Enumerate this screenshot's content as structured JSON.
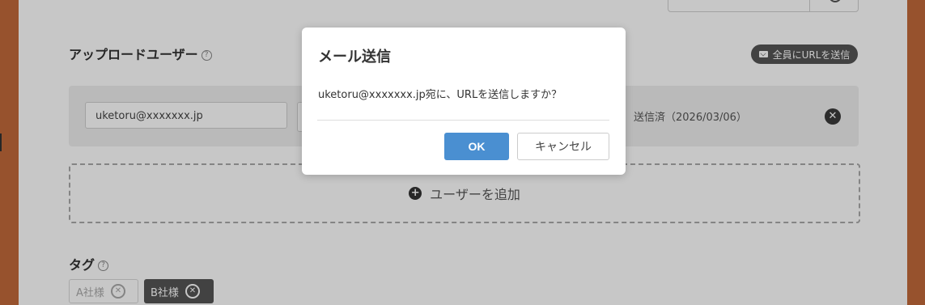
{
  "background": {
    "uploaders_section": {
      "title": "アップロードユーザー",
      "help_icon": "?",
      "send_all_button": "全員にURLを送信",
      "user": {
        "email": "uketoru@xxxxxxx.jp",
        "status": "送信済（2026/03/06）"
      },
      "add_user_label": "ユーザーを追加"
    },
    "tags_section": {
      "title": "タグ",
      "help_icon": "?",
      "tags": [
        "A社様",
        "B社様"
      ]
    }
  },
  "dialog": {
    "title": "メール送信",
    "message": "uketoru@xxxxxxx.jp宛に、URLを送信しますか？",
    "ok_label": "OK",
    "cancel_label": "キャンセル"
  },
  "colors": {
    "accent_ok": "#4a8fd1",
    "dark_pill": "#555555",
    "frame": "#c26a3a"
  }
}
